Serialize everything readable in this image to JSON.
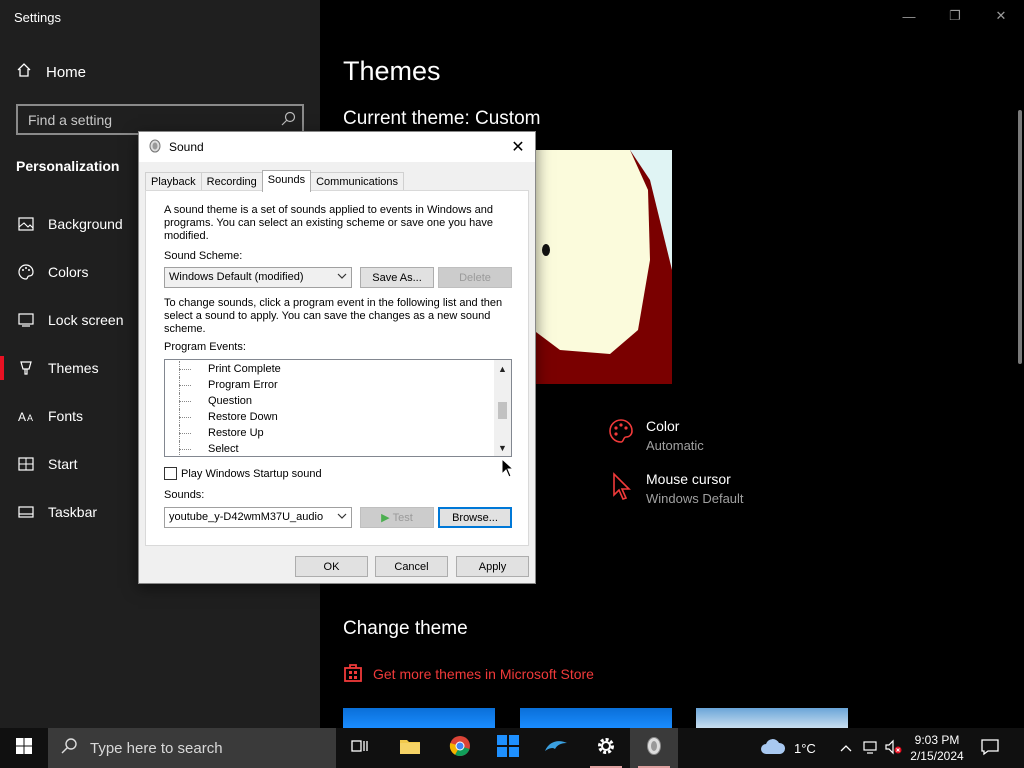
{
  "settings": {
    "window_title": "Settings",
    "home_label": "Home",
    "search_placeholder": "Find a setting",
    "section_title": "Personalization",
    "nav": [
      {
        "label": "Background",
        "icon": "picture-icon"
      },
      {
        "label": "Colors",
        "icon": "palette-icon"
      },
      {
        "label": "Lock screen",
        "icon": "lock-screen-icon"
      },
      {
        "label": "Themes",
        "icon": "themes-icon",
        "active": true
      },
      {
        "label": "Fonts",
        "icon": "fonts-icon"
      },
      {
        "label": "Start",
        "icon": "start-icon"
      },
      {
        "label": "Taskbar",
        "icon": "taskbar-icon"
      }
    ],
    "accent_color": "#e81123"
  },
  "main": {
    "page_title": "Themes",
    "current_theme": "Current theme: Custom",
    "color_title": "Color",
    "color_value": "Automatic",
    "cursor_title": "Mouse cursor",
    "cursor_value": "Windows Default",
    "change_theme": "Change theme",
    "store_link": "Get more themes in Microsoft Store",
    "link_color": "#f03a3a"
  },
  "dialog": {
    "title": "Sound",
    "tabs": [
      "Playback",
      "Recording",
      "Sounds",
      "Communications"
    ],
    "active_tab": "Sounds",
    "intro": "A sound theme is a set of sounds applied to events in Windows and programs.  You can select an existing scheme or save one you have modified.",
    "scheme_label": "Sound Scheme:",
    "scheme_value": "Windows Default (modified)",
    "save_as": "Save As...",
    "delete": "Delete",
    "instructions": "To change sounds, click a program event in the following list and then select a sound to apply.  You can save the changes as a new sound scheme.",
    "events_label": "Program Events:",
    "events": [
      "Print Complete",
      "Program Error",
      "Question",
      "Restore Down",
      "Restore Up",
      "Select"
    ],
    "startup_sound": "Play Windows Startup sound",
    "startup_checked": false,
    "sounds_label": "Sounds:",
    "sound_value": "youtube_y-D42wmM37U_audio",
    "test": "Test",
    "browse": "Browse...",
    "ok": "OK",
    "cancel": "Cancel",
    "apply": "Apply"
  },
  "taskbar": {
    "search_placeholder": "Type here to search",
    "weather_temp": "1°C",
    "time": "9:03 PM",
    "date": "2/15/2024",
    "pinned": [
      "task-view-icon",
      "file-explorer-icon",
      "chrome-icon",
      "windows-store-icon",
      "dolphin-icon",
      "settings-gear-icon",
      "sound-app-icon"
    ]
  }
}
